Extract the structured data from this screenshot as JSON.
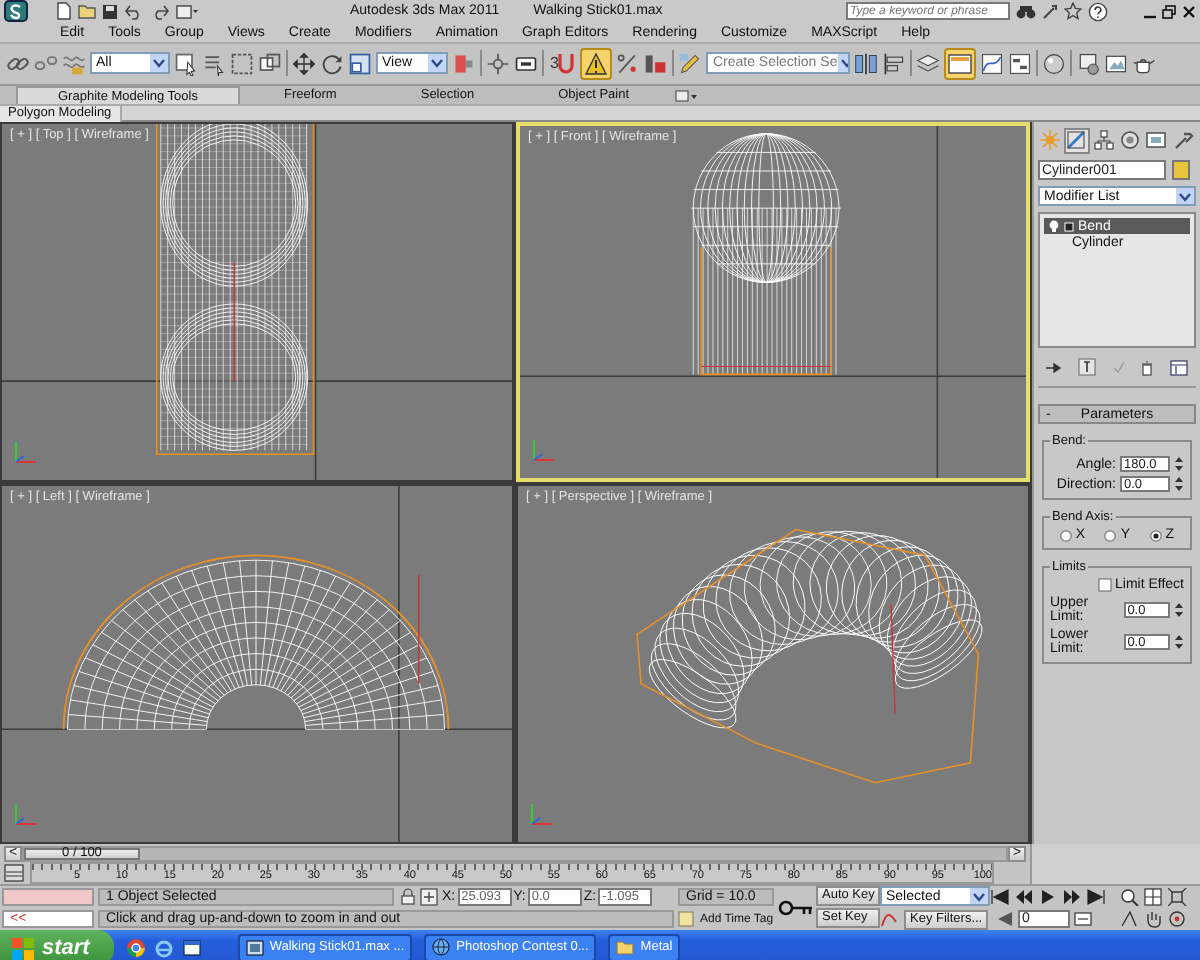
{
  "title_bar": {
    "app": "Autodesk 3ds Max  2011",
    "document": "Walking Stick01.max",
    "search": {
      "placeholder": "Type a keyword or phrase"
    }
  },
  "menu": [
    "Edit",
    "Tools",
    "Group",
    "Views",
    "Create",
    "Modifiers",
    "Animation",
    "Graph Editors",
    "Rendering",
    "Customize",
    "MAXScript",
    "Help"
  ],
  "toolbar": {
    "selection_filter": "All",
    "reference_coordinate_system": "View",
    "snap_toggle": "3",
    "named_selection_set": "Create Selection Se"
  },
  "ribbon": {
    "tabs": [
      {
        "label": "Graphite Modeling Tools",
        "selected": true
      },
      {
        "label": "Freeform",
        "selected": false
      },
      {
        "label": "Selection",
        "selected": false
      },
      {
        "label": "Object Paint",
        "selected": false
      }
    ],
    "panel": "Polygon Modeling"
  },
  "viewports": [
    {
      "label": "[ + ] [ Top ] [ Wireframe ]",
      "kind": "top",
      "selected": false
    },
    {
      "label": "[ + ] [ Front ] [ Wireframe ]",
      "kind": "front",
      "selected": true
    },
    {
      "label": "[ + ] [ Left ] [ Wireframe ]",
      "kind": "left",
      "selected": false
    },
    {
      "label": "[ + ] [ Perspective ] [ Wireframe ]",
      "kind": "perspective",
      "selected": false
    }
  ],
  "command_panel": {
    "tabs": [
      {
        "kind": "create",
        "selected": false
      },
      {
        "kind": "modify",
        "selected": true
      },
      {
        "kind": "hierarchy",
        "selected": false
      },
      {
        "kind": "motion",
        "selected": false
      },
      {
        "kind": "display",
        "selected": false
      },
      {
        "kind": "utilities",
        "selected": false
      }
    ],
    "object_name": "Cylinder001",
    "modifier_list": "Modifier List",
    "stack": [
      {
        "label": "Bend",
        "selected": true
      },
      {
        "label": "Cylinder",
        "selected": false
      }
    ],
    "rollout": {
      "toggle": "-",
      "title": "Parameters",
      "bend": {
        "title": "Bend:",
        "fields": [
          {
            "label": "Angle:",
            "value": "180.0"
          },
          {
            "label": "Direction:",
            "value": "0.0"
          }
        ]
      },
      "bend_axis": {
        "title": "Bend Axis:",
        "options": [
          {
            "label": "X",
            "selected": false
          },
          {
            "label": "Y",
            "selected": false
          },
          {
            "label": "Z",
            "selected": true
          }
        ]
      },
      "limits": {
        "title": "Limits",
        "limit_effect": {
          "label": "Limit Effect",
          "checked": false
        },
        "fields": [
          {
            "label": "Upper Limit:",
            "value": "0.0"
          },
          {
            "label": "Lower Limit:",
            "value": "0.0"
          }
        ]
      }
    }
  },
  "time_slider": {
    "prev": "<",
    "label": "0 / 100",
    "next": ">",
    "level": 0
  },
  "track_bar": {
    "ticks": [
      "5",
      "10",
      "15",
      "20",
      "25",
      "30",
      "35",
      "40",
      "45",
      "50",
      "55",
      "60",
      "65",
      "70",
      "75",
      "80",
      "85",
      "90",
      "95",
      "100"
    ]
  },
  "status": {
    "script_toggle": "<<",
    "selection": "1 Object Selected",
    "prompt": "Click and drag up-and-down to zoom in and out",
    "coords": [
      {
        "axis": "X:",
        "value": "25.093"
      },
      {
        "axis": "Y:",
        "value": "0.0"
      },
      {
        "axis": "Z:",
        "value": "-1.095"
      }
    ],
    "grid": "Grid = 10.0",
    "add_time_tag": "Add Time Tag",
    "auto_key": "Auto Key",
    "key_set": "Selected",
    "set_key": "Set Key",
    "key_filters": "Key Filters...",
    "frame": "0"
  },
  "taskbar": {
    "start": "start",
    "tasks": [
      {
        "kind": "max",
        "label": "Walking Stick01.max ..."
      },
      {
        "kind": "browser",
        "label": "Photoshop Contest 0..."
      },
      {
        "kind": "folder",
        "label": "Metal"
      }
    ]
  }
}
